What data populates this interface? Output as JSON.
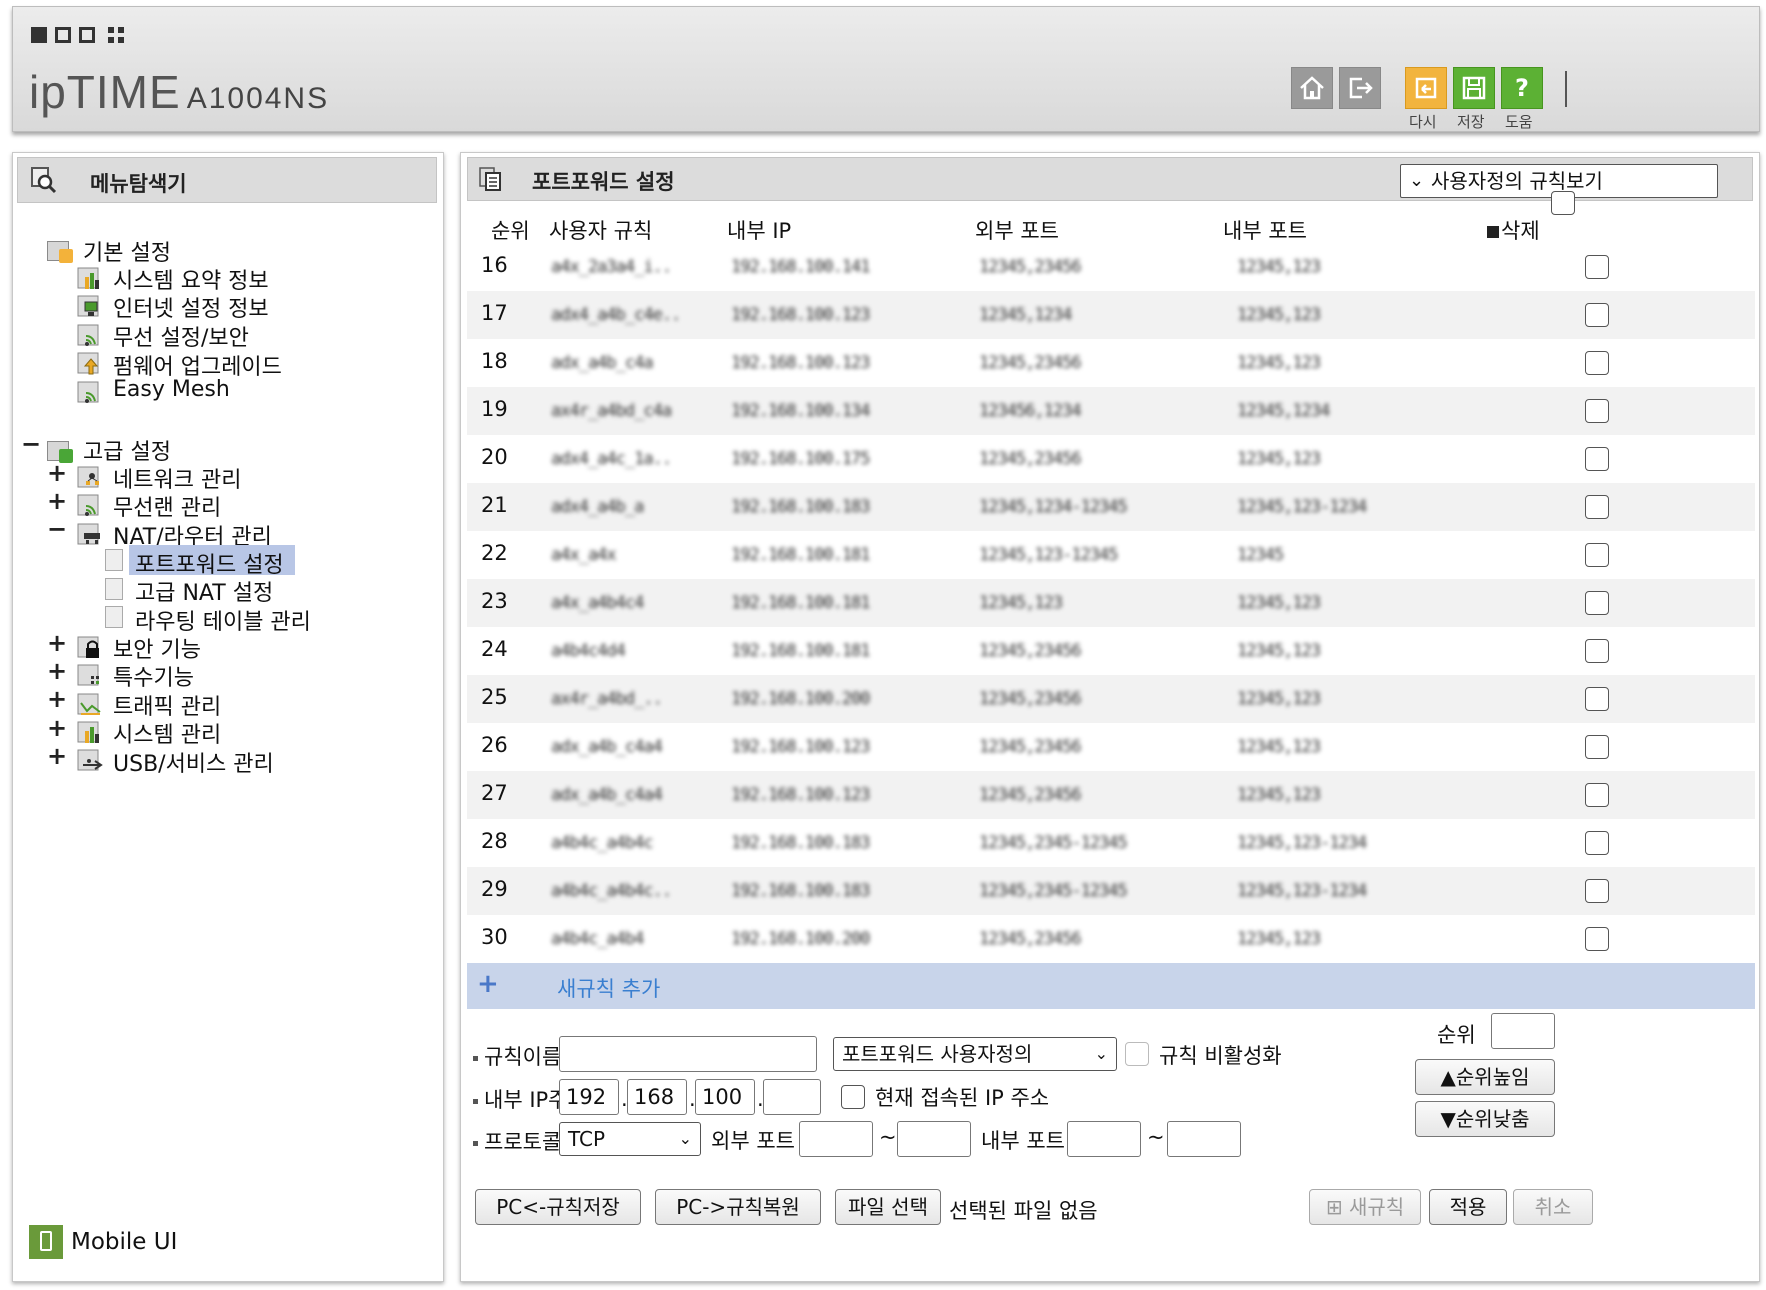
{
  "header": {
    "brand": "ipTIME",
    "model": "A1004NS",
    "buttons": {
      "reload": "다시",
      "save": "저장",
      "help": "도움"
    }
  },
  "sidebar": {
    "title": "메뉴탐색기",
    "basic": {
      "label": "기본 설정",
      "items": [
        "시스템 요약 정보",
        "인터넷 설정 정보",
        "무선 설정/보안",
        "펌웨어 업그레이드",
        "Easy Mesh"
      ]
    },
    "advanced": {
      "label": "고급 설정",
      "items": [
        "네트워크 관리",
        "무선랜 관리",
        "NAT/라우터 관리",
        "보안 기능",
        "특수기능",
        "트래픽 관리",
        "시스템 관리",
        "USB/서비스 관리"
      ],
      "nat_sub": [
        "포트포워드 설정",
        "고급 NAT 설정",
        "라우팅 테이블 관리"
      ]
    },
    "mobile_ui": "Mobile UI"
  },
  "main": {
    "title": "포트포워드 설정",
    "view_select": "사용자정의 규칙보기",
    "columns": {
      "rank": "순위",
      "rule": "사용자 규칙",
      "internal_ip": "내부 IP",
      "external_port": "외부 포트",
      "internal_port": "내부 포트",
      "delete": "삭제"
    },
    "rows": [
      {
        "rank": "16",
        "rule": "a4x_2a3a4_i..",
        "ip": "192.168.100.141",
        "ext": "12345,23456",
        "int": "12345,123"
      },
      {
        "rank": "17",
        "rule": "adx4_a4b_c4e..",
        "ip": "192.168.100.123",
        "ext": "12345,1234",
        "int": "12345,123"
      },
      {
        "rank": "18",
        "rule": "adx_a4b_c4a",
        "ip": "192.168.100.123",
        "ext": "12345,23456",
        "int": "12345,123"
      },
      {
        "rank": "19",
        "rule": "ax4r_a4bd_c4a",
        "ip": "192.168.100.134",
        "ext": "123456,1234",
        "int": "12345,1234"
      },
      {
        "rank": "20",
        "rule": "adx4_a4c_1a..",
        "ip": "192.168.100.175",
        "ext": "12345,23456",
        "int": "12345,123"
      },
      {
        "rank": "21",
        "rule": "adx4_a4b_a",
        "ip": "192.168.100.183",
        "ext": "12345,1234-12345",
        "int": "12345,123-1234"
      },
      {
        "rank": "22",
        "rule": "a4x_a4x",
        "ip": "192.168.100.181",
        "ext": "12345,123-12345",
        "int": "12345"
      },
      {
        "rank": "23",
        "rule": "a4x_a4b4c4",
        "ip": "192.168.100.181",
        "ext": "12345,123",
        "int": "12345,123"
      },
      {
        "rank": "24",
        "rule": "a4b4c4d4",
        "ip": "192.168.100.181",
        "ext": "12345,23456",
        "int": "12345,123"
      },
      {
        "rank": "25",
        "rule": "ax4r_a4bd_..",
        "ip": "192.168.100.200",
        "ext": "12345,23456",
        "int": "12345,123"
      },
      {
        "rank": "26",
        "rule": "adx_a4b_c4a4",
        "ip": "192.168.100.123",
        "ext": "12345,23456",
        "int": "12345,123"
      },
      {
        "rank": "27",
        "rule": "adx_a4b_c4a4",
        "ip": "192.168.100.123",
        "ext": "12345,23456",
        "int": "12345,123"
      },
      {
        "rank": "28",
        "rule": "a4b4c_a4b4c",
        "ip": "192.168.100.183",
        "ext": "12345,2345-12345",
        "int": "12345,123-1234"
      },
      {
        "rank": "29",
        "rule": "a4b4c_a4b4c..",
        "ip": "192.168.100.183",
        "ext": "12345,2345-12345",
        "int": "12345,123-1234"
      },
      {
        "rank": "30",
        "rule": "a4b4c_a4b4",
        "ip": "192.168.100.200",
        "ext": "12345,23456",
        "int": "12345,123"
      }
    ],
    "add_rule": "새규칙 추가",
    "form": {
      "rule_name_label": "규칙이름",
      "rule_name_value": "",
      "preset_select": "포트포워드 사용자정의",
      "disable_label": "규칙 비활성화",
      "internal_ip_label": "내부 IP주소",
      "ip1": "192",
      "ip2": "168",
      "ip3": "100",
      "ip4": "",
      "current_ip_label": "현재 접속된 IP 주소",
      "protocol_label": "프로토콜",
      "protocol_value": "TCP",
      "external_port_label": "외부 포트",
      "internal_port_label": "내부 포트",
      "tilde": "~",
      "rank_label": "순위",
      "rank_value": "",
      "rank_up": "순위높임",
      "rank_down": "순위낮춤"
    },
    "footer": {
      "save_to_pc": "PC<-규칙저장",
      "restore_from_pc": "PC->규칙복원",
      "file_select": "파일 선택",
      "no_file": "선택된 파일 없음",
      "new_rule": "새규칙",
      "apply": "적용",
      "cancel": "취소"
    }
  }
}
